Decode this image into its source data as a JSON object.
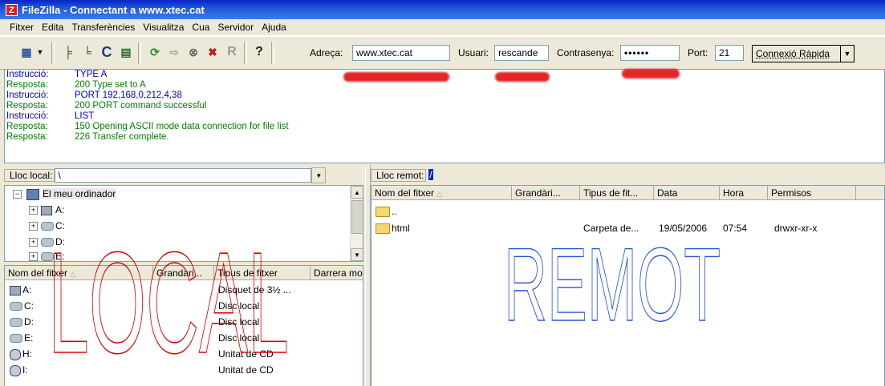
{
  "window": {
    "title": "FileZilla - Connectant a www.xtec.cat"
  },
  "menu": [
    "Fitxer",
    "Edita",
    "Transferències",
    "Visualitza",
    "Cua",
    "Servidor",
    "Ajuda"
  ],
  "quickconnect": {
    "host_label": "Adreça:",
    "host_value": "www.xtec.cat",
    "user_label": "Usuari:",
    "user_value": "rescande",
    "pass_label": "Contrasenya:",
    "pass_value": "••••••",
    "port_label": "Port:",
    "port_value": "21",
    "button_label": "Connexió Ràpida"
  },
  "log": [
    {
      "type": "Instrucció:",
      "text": "TYPE A",
      "kind": "cmd"
    },
    {
      "type": "Resposta:",
      "text": "200 Type set to A",
      "kind": "resp"
    },
    {
      "type": "Instrucció:",
      "text": "PORT 192,168,0,212,4,38",
      "kind": "cmd"
    },
    {
      "type": "Resposta:",
      "text": "200 PORT command successful",
      "kind": "resp"
    },
    {
      "type": "Instrucció:",
      "text": "LIST",
      "kind": "cmd"
    },
    {
      "type": "Resposta:",
      "text": "150 Opening ASCII mode data connection for file list",
      "kind": "resp"
    },
    {
      "type": "Resposta:",
      "text": "226 Transfer complete.",
      "kind": "resp"
    }
  ],
  "local": {
    "path_label": "Lloc local:",
    "path_value": "\\",
    "tree": [
      {
        "label": "El meu ordinador",
        "expander": "−"
      },
      {
        "label": "A:",
        "expander": "+"
      },
      {
        "label": "C:",
        "expander": "+"
      },
      {
        "label": "D:",
        "expander": "+"
      },
      {
        "label": "E:",
        "expander": "+"
      }
    ],
    "columns": [
      "Nom del fitxer",
      "Grandàri...",
      "Tipus de fitxer",
      "Darrera mo"
    ],
    "files": [
      {
        "name": "A:",
        "type": "Disquet de 3½ ..."
      },
      {
        "name": "C:",
        "type": "Disc local"
      },
      {
        "name": "D:",
        "type": "Disc local"
      },
      {
        "name": "E:",
        "type": "Disc local"
      },
      {
        "name": "H:",
        "type": "Unitat de CD"
      },
      {
        "name": "I:",
        "type": "Unitat de CD"
      }
    ],
    "overlay": "LOCAL"
  },
  "remote": {
    "path_label": "Lloc remot:",
    "path_value": "/",
    "columns": [
      "Nom del fitxer",
      "Grandàri...",
      "Tipus de fit...",
      "Data",
      "Hora",
      "Permisos"
    ],
    "files": [
      {
        "name": "..",
        "type": "",
        "date": "",
        "time": "",
        "perms": ""
      },
      {
        "name": "html",
        "type": "Carpeta de...",
        "date": "19/05/2006",
        "time": "07:54",
        "perms": "drwxr-xr-x"
      }
    ],
    "overlay": "REMOT"
  },
  "colors": {
    "overlay_local": "#e00000",
    "overlay_remote": "#2050e0",
    "cmd": "#0000c0",
    "resp": "#008000"
  }
}
